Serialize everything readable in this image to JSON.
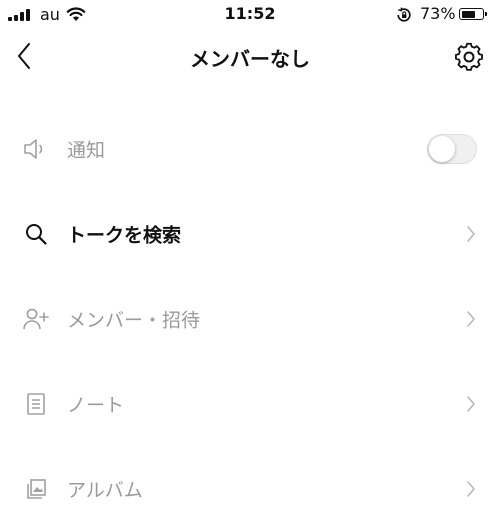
{
  "status_bar": {
    "carrier": "au",
    "time": "11:52",
    "battery_percent": "73%",
    "battery_level": 0.73,
    "icons": [
      "signal-icon",
      "wifi-icon",
      "rotation-lock-icon",
      "battery-icon"
    ]
  },
  "header": {
    "title": "メンバーなし",
    "back_icon": "chevron-left-icon",
    "settings_icon": "gear-icon"
  },
  "menu": {
    "items": [
      {
        "label": "通知",
        "icon": "speaker-icon",
        "control": "toggle",
        "toggle_on": false
      },
      {
        "label": "トークを検索",
        "icon": "search-icon",
        "control": "chevron"
      },
      {
        "label": "メンバー・招待",
        "icon": "add-user-icon",
        "control": "chevron"
      },
      {
        "label": "ノート",
        "icon": "note-icon",
        "control": "chevron"
      },
      {
        "label": "アルバム",
        "icon": "album-icon",
        "control": "chevron"
      }
    ]
  },
  "colors": {
    "text_primary": "#111111",
    "text_disabled": "#9a9a9a",
    "icon_disabled": "#a0a0a0",
    "chevron": "#b8b8b8",
    "toggle_off_bg": "#f0f0f0"
  }
}
